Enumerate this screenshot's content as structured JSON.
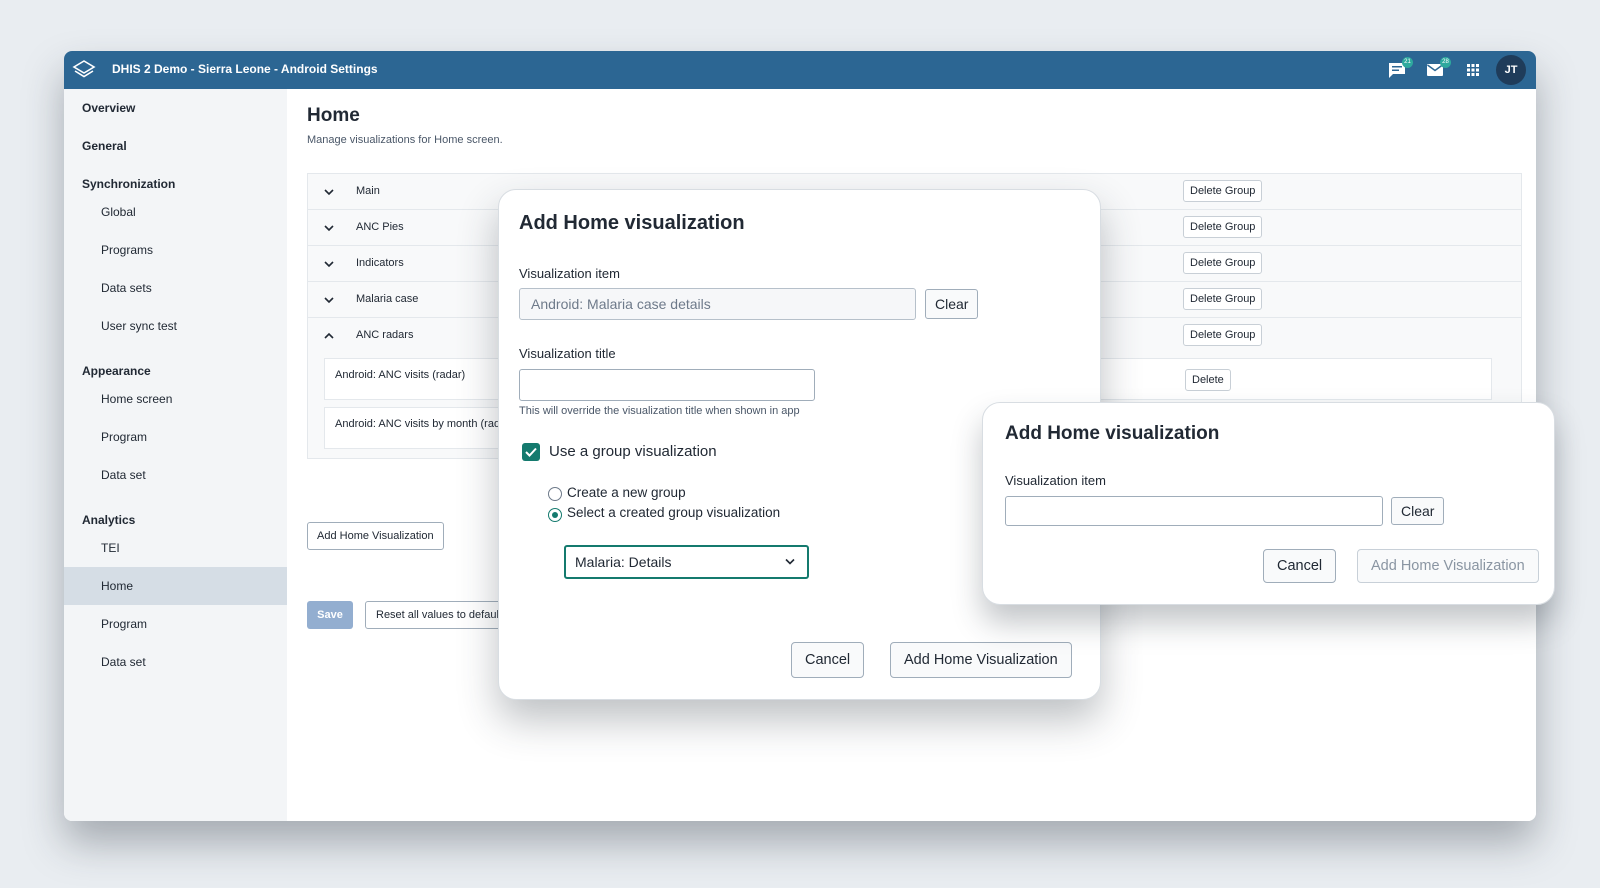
{
  "header": {
    "app_title": "DHIS 2 Demo - Sierra Leone - Android Settings",
    "interpretations_count": "21",
    "messages_count": "28",
    "user_initials": "JT",
    "brand_color": "#2c6693"
  },
  "sidebar": {
    "overview": "Overview",
    "general": "General",
    "synchronization": "Synchronization",
    "sync_items": [
      "Global",
      "Programs",
      "Data sets",
      "User sync test"
    ],
    "appearance": "Appearance",
    "appearance_items": [
      "Home screen",
      "Program",
      "Data set"
    ],
    "analytics": "Analytics",
    "analytics_items": [
      "TEI",
      "Home",
      "Program",
      "Data set"
    ],
    "active_item": "Home"
  },
  "page": {
    "title": "Home",
    "description": "Manage visualizations for Home screen.",
    "groups": [
      {
        "name": "Main",
        "expanded": false
      },
      {
        "name": "ANC Pies",
        "expanded": false
      },
      {
        "name": "Indicators",
        "expanded": false
      },
      {
        "name": "Malaria case",
        "expanded": false
      },
      {
        "name": "ANC radars",
        "expanded": true
      }
    ],
    "delete_group_label": "Delete Group",
    "visualizations": [
      "Android: ANC visits (radar)",
      "Android: ANC visits by month (radar)"
    ],
    "delete_label": "Delete",
    "add_button": "Add Home Visualization",
    "save_button": "Save",
    "reset_button": "Reset all values to default"
  },
  "dialog1": {
    "title": "Add Home visualization",
    "item_label": "Visualization item",
    "item_value": "Android: Malaria case details",
    "clear_button": "Clear",
    "title_label": "Visualization title",
    "title_value": "",
    "title_helper": "This will override the visualization title when shown in app",
    "use_group_label": "Use a group visualization",
    "use_group_checked": true,
    "radio_new": "Create a new group",
    "radio_select": "Select a created group visualization",
    "selected_radio": "Select a created group visualization",
    "group_select_value": "Malaria: Details",
    "cancel_button": "Cancel",
    "confirm_button": "Add Home Visualization"
  },
  "dialog2": {
    "title": "Add Home visualization",
    "item_label": "Visualization item",
    "item_value": "",
    "clear_button": "Clear",
    "cancel_button": "Cancel",
    "confirm_button": "Add Home Visualization"
  },
  "colors": {
    "accent": "#147a6e",
    "save_disabled": "#93aed0"
  }
}
